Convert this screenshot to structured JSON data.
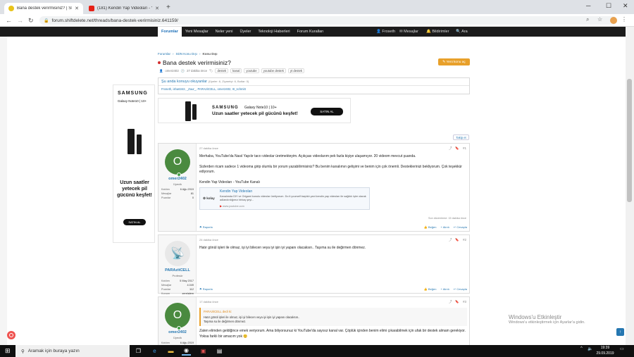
{
  "browser": {
    "tabs": [
      {
        "title": "Bana destek verirmisiniz? | SDN",
        "active": true
      },
      {
        "title": "(181) Kendin Yap Videoları - You",
        "active": false
      }
    ],
    "url": "forum.shiftdelete.net/threads/bana-destek-verirmisiniz.641159/"
  },
  "sitenav": {
    "items": [
      "Forumlar",
      "Yeni Mesajlar",
      "Neler yeni",
      "Üyeler",
      "Teknoloji Haberleri",
      "Forum Kuralları"
    ],
    "right": [
      "Froseth",
      "Mesajlar",
      "Bildirimler",
      "Ara"
    ]
  },
  "breadcrumb": [
    "Forumlar",
    "SDN Konu Dışı",
    "Konu Dışı"
  ],
  "thread": {
    "title": "Bana destek verirmisiniz?",
    "author": "omer2402",
    "time": "27 dakika önce",
    "tags": [
      "destek",
      "kanal",
      "youtube",
      "youtube destek",
      "yt destek"
    ],
    "new_topic": "Yeni konu aç"
  },
  "online": {
    "header": "Şu anda konuyu okuyanlar",
    "sub": "(Üyeler: 6, Ziyaretçi: 6, Botlar: 0)",
    "list": "Froseth, isha6342, _Zaur_, PARAzitCELL, omer2402, III_schmitt"
  },
  "ads": {
    "brand": "SAMSUNG",
    "product": "Galaxy Note10 | 10+",
    "slogan_top": "Uzun saatler yetecek pil gücünü keşfet!",
    "slogan_side": "Uzun saatler yetecek pil gücünü keşfet!",
    "buy": "SATIN AL"
  },
  "filter_label": "Takip et",
  "posts": [
    {
      "user": "omer2402",
      "rank": "Üyecik",
      "av": "O",
      "stats": [
        [
          "Katılım",
          "6 Ağu 2019"
        ],
        [
          "Mesajlar",
          "81"
        ],
        [
          "Puanlar",
          "0"
        ]
      ],
      "time": "27 dakika önce",
      "num": "#1",
      "paras": [
        "Merhaba, YouTube'da Nasıl Yapılır tarzı videolar üretmekteyim. Açıkçası videolarım pek fazla kişiye ulaşamıyor. 20 videom mevcut şuanda.",
        "Sizlerden ricam sadece 1 videoma girip olumlu bir yorum yazabilirmisiniz? Bu benim kanalımın gelişimi ve benim için çok önemli. Desteklerinizi bekliyorum. Çok teşekkür ediyorum.",
        "Kendin Yap Videoları - YouTube Kanalı"
      ],
      "card": {
        "logo": "kolay",
        "title": "Kendin Yap Videoları",
        "desc": "Kanalımda DIY ve Origami konulu videolar üretiyorum. Do it yourself başlıklı yani kendin yap videoları ile sağlıklı işler olarak adlandırdığımız birkaç şeyi...",
        "url": "www.youtube.com"
      },
      "edited": "Son düzenleme: 15 dakika önce",
      "report": "Raporla",
      "actions": [
        "Beğen",
        "Alıntı",
        "Cevapla"
      ]
    },
    {
      "user": "PARAzitCELL",
      "rank": "Profesör",
      "av": "P",
      "stats": [
        [
          "Katılım",
          "5 May 2017"
        ],
        [
          "Mesajlar",
          "4.049"
        ],
        [
          "Puanlar",
          "112"
        ],
        [
          "Konum",
          "zerelalem"
        ]
      ],
      "time": "24 dakika önce",
      "num": "#2",
      "paras": [
        "Hatır gönül işleri ile olmaz, işi iyi bilecen veya iyi işin iyi yapanı olacaksın.. Taşıma su ile değirmen dönmez."
      ],
      "report": "Raporla",
      "actions": [
        "Beğen",
        "Alıntı",
        "Cevapla"
      ]
    },
    {
      "user": "omer2402",
      "rank": "Üyecik",
      "av": "O",
      "stats": [
        [
          "Katılım",
          "6 Ağu 2019"
        ]
      ],
      "time": "17 dakika önce",
      "num": "#3",
      "quote_head": "PARAzitCELL dedi ki:",
      "quote_lines": [
        "Hatır gönül işleri ile olmaz, işi iyi bilecen veya iyi işin iyi yapanı olacaksın..",
        "Taşıma su ile değirmen dönmez."
      ],
      "paras": [
        "Zaten elimden geldiğince emek veriyorum. Ama biliyorsunuz ki YouTube'da sayısız kanal var. Çöplük içinden benim elimi çıkarabilmek için ufak bir destek almam gerekiyor. Yoksa farklı bir amacım yok 😊"
      ]
    }
  ],
  "watermark": {
    "line1": "Windows'u Etkinleştir",
    "line2": "Windows'u etkinleştirmek için Ayarlar'a gidin."
  },
  "taskbar": {
    "search": "Aramak için buraya yazın",
    "time": "19:39",
    "date": "29.09.2019"
  }
}
